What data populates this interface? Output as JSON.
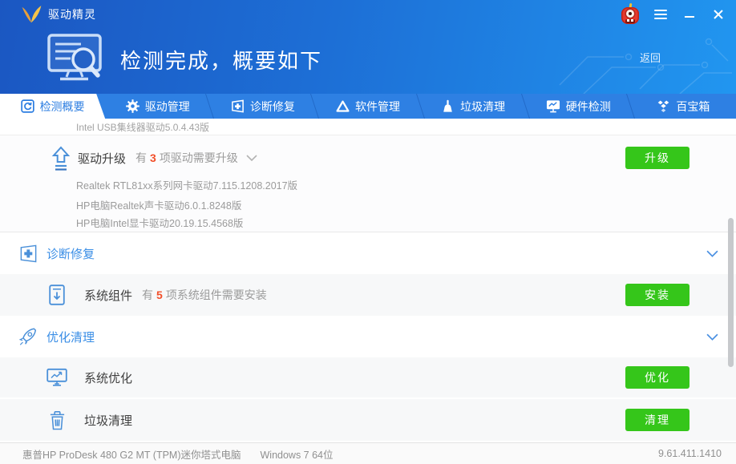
{
  "colors": {
    "banner_gradient_start": "#1b57c2",
    "banner_gradient_end": "#2196f0",
    "tabbar_bg": "#2e80e3",
    "active_tab_text": "#2b7de1",
    "section_title_blue": "#3a8ee6",
    "content_icon_blue": "#4a90d9",
    "green_button": "#35c61a",
    "red_count": "#f24f2a",
    "text_dark": "#3f3f3f",
    "text_gray": "#9b9b9b"
  },
  "titlebar": {
    "app_name": "驱动精灵"
  },
  "header": {
    "title": "检测完成，概要如下",
    "back_label": "返回"
  },
  "tabs": [
    {
      "label": "检测概要",
      "icon": "scan-summary-icon",
      "active": true
    },
    {
      "label": "驱动管理",
      "icon": "gear-icon",
      "active": false
    },
    {
      "label": "诊断修复",
      "icon": "repair-cross-icon",
      "active": false
    },
    {
      "label": "软件管理",
      "icon": "software-triangle-icon",
      "active": false
    },
    {
      "label": "垃圾清理",
      "icon": "broom-icon",
      "active": false
    },
    {
      "label": "硬件检测",
      "icon": "hardware-monitor-icon",
      "active": false
    },
    {
      "label": "百宝箱",
      "icon": "toolbox-icon",
      "active": false
    }
  ],
  "content": {
    "scrolled_item": "Intel USB集线器驱动5.0.4.43版",
    "driver_upgrade": {
      "title": "驱动升级",
      "summary_prefix": "有",
      "count": "3",
      "summary_suffix": "项驱动需要升级",
      "button_label": "升级",
      "items": [
        "Realtek RTL81xx系列网卡驱动7.115.1208.2017版",
        "HP电脑Realtek声卡驱动6.0.1.8248版",
        "HP电脑Intel显卡驱动20.19.15.4568版"
      ]
    },
    "diagnose_section": {
      "title": "诊断修复"
    },
    "system_component": {
      "title": "系统组件",
      "summary_prefix": "有",
      "count": "5",
      "summary_suffix": "项系统组件需要安装",
      "button_label": "安装"
    },
    "optimize_section": {
      "title": "优化清理"
    },
    "system_optimize": {
      "title": "系统优化",
      "button_label": "优化"
    },
    "junk_clean": {
      "title": "垃圾清理",
      "button_label": "清理"
    }
  },
  "statusbar": {
    "computer_model": "惠普HP ProDesk 480 G2 MT (TPM)迷你塔式电脑",
    "os": "Windows 7 64位",
    "version": "9.61.411.1410"
  }
}
